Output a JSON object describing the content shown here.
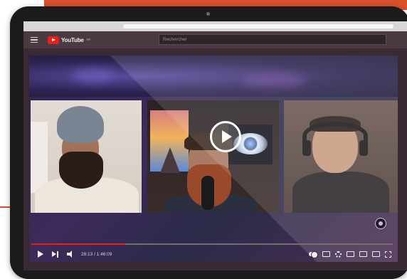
{
  "youtube": {
    "logo_text": "YouTube",
    "logo_superscript": "FR",
    "search_placeholder": "Rechercher"
  },
  "player": {
    "time_display": "28:13 / 1:46:09",
    "progress_percent": 26
  },
  "colors": {
    "accent": "#d9502a",
    "youtube_red": "#e62117"
  },
  "icons": [
    "menu-icon",
    "youtube-logo",
    "play-button-icon",
    "play-icon",
    "next-icon",
    "volume-muted-icon",
    "autoplay-toggle-icon",
    "subtitles-icon",
    "settings-icon",
    "miniplayer-icon",
    "theater-mode-icon",
    "cast-icon",
    "fullscreen-icon",
    "channel-watermark-icon"
  ]
}
